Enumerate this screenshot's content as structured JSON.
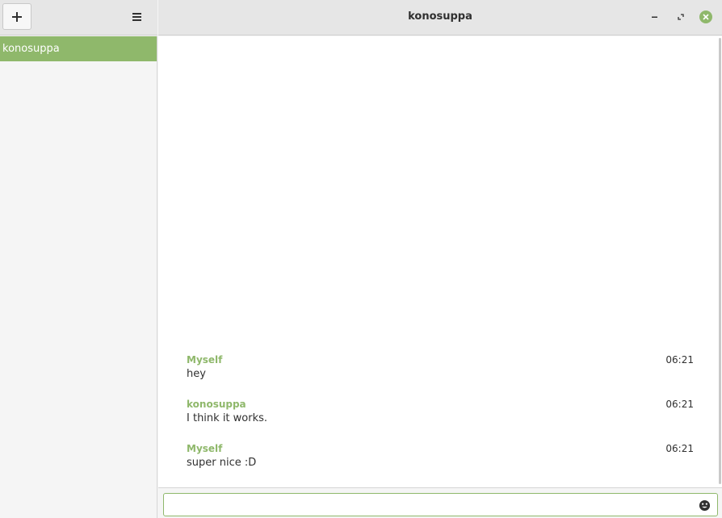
{
  "window": {
    "title": "konosuppa",
    "accent": "#8fb86b"
  },
  "toolbar": {
    "add_icon": "plus-icon",
    "menu_icon": "hamburger-menu-icon"
  },
  "window_controls": {
    "minimize_icon": "minimize-icon",
    "maximize_icon": "restore-icon",
    "close_icon": "close-icon"
  },
  "sidebar": {
    "contacts": [
      {
        "name": "konosuppa",
        "selected": true
      }
    ]
  },
  "messages": [
    {
      "sender": "Myself",
      "time": "06:21",
      "text": "hey"
    },
    {
      "sender": "konosuppa",
      "time": "06:21",
      "text": "I think it works."
    },
    {
      "sender": "Myself",
      "time": "06:21",
      "text": "super nice :D"
    }
  ],
  "composer": {
    "value": "",
    "emoji_icon": "smiley-icon"
  }
}
